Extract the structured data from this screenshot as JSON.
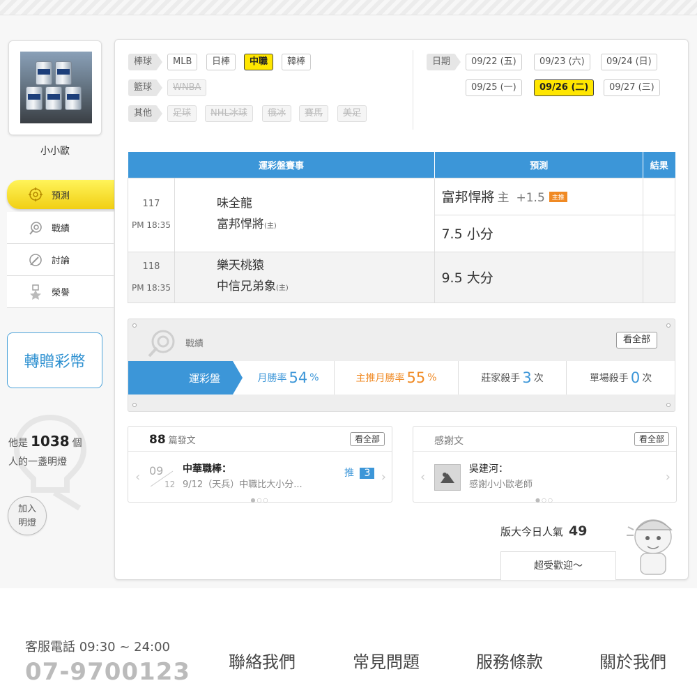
{
  "profile": {
    "name": "小小歐"
  },
  "sidebar": {
    "items": [
      {
        "label": "預測",
        "icon": "target-icon",
        "active": true
      },
      {
        "label": "戰績",
        "icon": "record-icon",
        "active": false
      },
      {
        "label": "討論",
        "icon": "discussion-icon",
        "active": false
      },
      {
        "label": "榮譽",
        "icon": "medal-icon",
        "active": false
      }
    ],
    "gift_label": "轉贈彩幣"
  },
  "lamp": {
    "prefix": "他是",
    "count": "1038",
    "suffix": "個",
    "line2": "人的一盞明燈",
    "add_line1": "加入",
    "add_line2": "明燈"
  },
  "filters": {
    "rows": [
      {
        "label": "棒球",
        "options": [
          {
            "text": "MLB",
            "state": "normal"
          },
          {
            "text": "日棒",
            "state": "normal"
          },
          {
            "text": "中職",
            "state": "selected"
          },
          {
            "text": "韓棒",
            "state": "normal"
          }
        ]
      },
      {
        "label": "籃球",
        "options": [
          {
            "text": "WNBA",
            "state": "disabled"
          }
        ]
      },
      {
        "label": "其他",
        "options": [
          {
            "text": "足球",
            "state": "disabled"
          },
          {
            "text": "NHL冰球",
            "state": "disabled"
          },
          {
            "text": "俄冰",
            "state": "disabled"
          },
          {
            "text": "賽馬",
            "state": "disabled"
          },
          {
            "text": "美足",
            "state": "disabled"
          }
        ]
      }
    ],
    "date_label": "日期",
    "dates": [
      {
        "text": "09/22 (五)",
        "state": "normal"
      },
      {
        "text": "09/23 (六)",
        "state": "normal"
      },
      {
        "text": "09/24 (日)",
        "state": "normal"
      },
      {
        "text": "09/25 (一)",
        "state": "normal"
      },
      {
        "text": "09/26 (二)",
        "state": "selected"
      },
      {
        "text": "09/27 (三)",
        "state": "normal"
      }
    ]
  },
  "table": {
    "headers": {
      "event": "運彩盤賽事",
      "prediction": "預測",
      "result": "結果"
    },
    "games": [
      {
        "no": "117",
        "time": "PM 18:35",
        "away": "味全龍",
        "home": "富邦悍將",
        "host_mark": "(主)",
        "preds": [
          {
            "team": "富邦悍將",
            "side": "主",
            "line": "+1.5",
            "badge": "主推"
          },
          {
            "text": "7.5 小分"
          }
        ]
      },
      {
        "no": "118",
        "time": "PM 18:35",
        "away": "樂天桃猿",
        "home": "中信兄弟象",
        "host_mark": "(主)",
        "preds": [
          {
            "text": "9.5 大分"
          }
        ]
      }
    ]
  },
  "record": {
    "title": "戰績",
    "more": "看全部",
    "tab": "運彩盤",
    "stats": [
      {
        "label": "月勝率",
        "value": "54",
        "unit": "%",
        "color": "blue"
      },
      {
        "label": "主推月勝率",
        "value": "55",
        "unit": "%",
        "color": "orange"
      },
      {
        "label": "莊家殺手",
        "value": "3",
        "unit": "次",
        "color": "gray"
      },
      {
        "label": "單場殺手",
        "value": "0",
        "unit": "次",
        "color": "gray"
      }
    ]
  },
  "posts": {
    "count": "88",
    "label": "篇發文",
    "more": "看全部",
    "item": {
      "month": "09",
      "day": "12",
      "title": "中華職棒：",
      "summary": "9/12（天兵）中職比大小分...",
      "push_label": "推",
      "push_count": "3"
    }
  },
  "thanks": {
    "title": "感謝文",
    "more": "看全部",
    "item": {
      "author": "吳建河：",
      "text": "感謝小小歐老師"
    }
  },
  "popularity": {
    "label": "版大今日人氣",
    "value": "49",
    "welcome": "超受歡迎～"
  },
  "footer": {
    "service_label": "客服電話 09:30 ~ 24:00",
    "phone": "07-9700123",
    "links": [
      "聯絡我們",
      "常見問題",
      "服務條款",
      "關於我們"
    ]
  },
  "colors": {
    "accent_blue": "#3c96d8",
    "accent_yellow": "#ffe600",
    "accent_orange": "#f08a24"
  }
}
